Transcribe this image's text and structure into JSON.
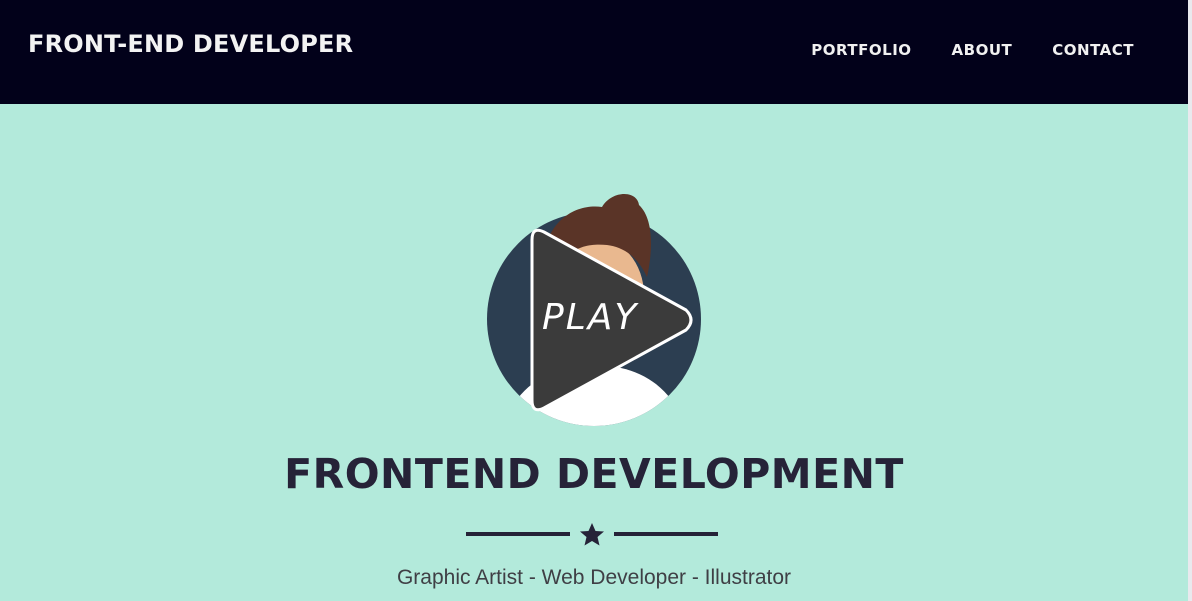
{
  "navbar": {
    "brand": "FRONT-END DEVELOPER",
    "links": [
      {
        "label": "PORTFOLIO"
      },
      {
        "label": "ABOUT"
      },
      {
        "label": "CONTACT"
      }
    ]
  },
  "hero": {
    "play_label": "PLAY",
    "title": "FRONTEND DEVELOPMENT",
    "subtitle": "Graphic Artist - Web Developer - Illustrator",
    "divider_icon": "star-icon",
    "avatar_icon": "developer-avatar-icon",
    "play_icon": "play-icon"
  },
  "colors": {
    "navbar_bg": "#02011a",
    "hero_bg": "#b3eadb",
    "title": "#262338",
    "play_button": "#3b3b3b"
  }
}
